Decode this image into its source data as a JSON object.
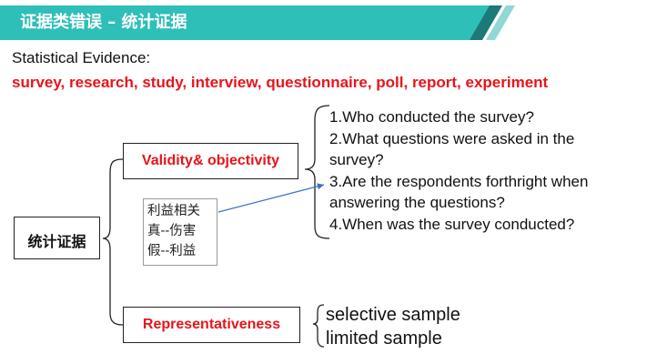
{
  "banner": {
    "title": "证据类错误 – 统计证据",
    "colors": {
      "band": "#2fbfb9",
      "stripe_dark": "#1c7a78",
      "stripe_light": "#8fd8d4"
    }
  },
  "heading": "Statistical Evidence:",
  "keywords": "survey, research, study, interview, questionnaire, poll, report, experiment",
  "root": {
    "label": "统计证据"
  },
  "validity": {
    "label": "Validity& objectivity",
    "questions": [
      "1.Who conducted the survey?",
      "2.What questions were asked in the",
      "survey?",
      "3.Are the respondents forthright when",
      "answering the questions?",
      "4.When was the survey conducted?"
    ]
  },
  "note": {
    "lines": [
      "利益相关",
      "真--伤害",
      "假--利益"
    ]
  },
  "representativeness": {
    "label": "Representativeness",
    "samples": [
      "selective sample",
      "limited sample"
    ]
  },
  "colors": {
    "red": "#e8141a",
    "arrow": "#3b6fc4"
  }
}
